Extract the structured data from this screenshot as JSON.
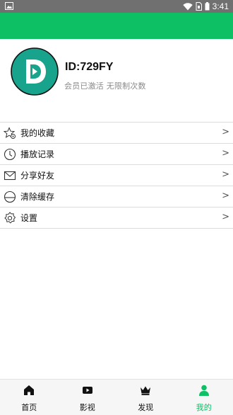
{
  "status_bar": {
    "time": "3:41",
    "accent": "#707070"
  },
  "app_bar": {
    "color": "#0cc063"
  },
  "profile": {
    "user_id": "ID:729FY",
    "status": "会员已激活 无限制次数",
    "avatar_colors": {
      "ring": "#111111",
      "fill": "#17a38c"
    }
  },
  "menu": {
    "items": [
      {
        "label": "我的收藏",
        "icon": "star-settings-icon"
      },
      {
        "label": "播放记录",
        "icon": "clock-icon"
      },
      {
        "label": "分享好友",
        "icon": "envelope-icon"
      },
      {
        "label": "清除缓存",
        "icon": "clear-circle-icon"
      },
      {
        "label": "设置",
        "icon": "gear-icon"
      }
    ],
    "arrow": ">"
  },
  "tab_bar": {
    "active_color": "#0cc063",
    "tabs": [
      {
        "label": "首页",
        "icon": "home-icon",
        "active": false
      },
      {
        "label": "影视",
        "icon": "video-icon",
        "active": false
      },
      {
        "label": "发现",
        "icon": "crown-icon",
        "active": false
      },
      {
        "label": "我的",
        "icon": "person-icon",
        "active": true
      }
    ]
  }
}
